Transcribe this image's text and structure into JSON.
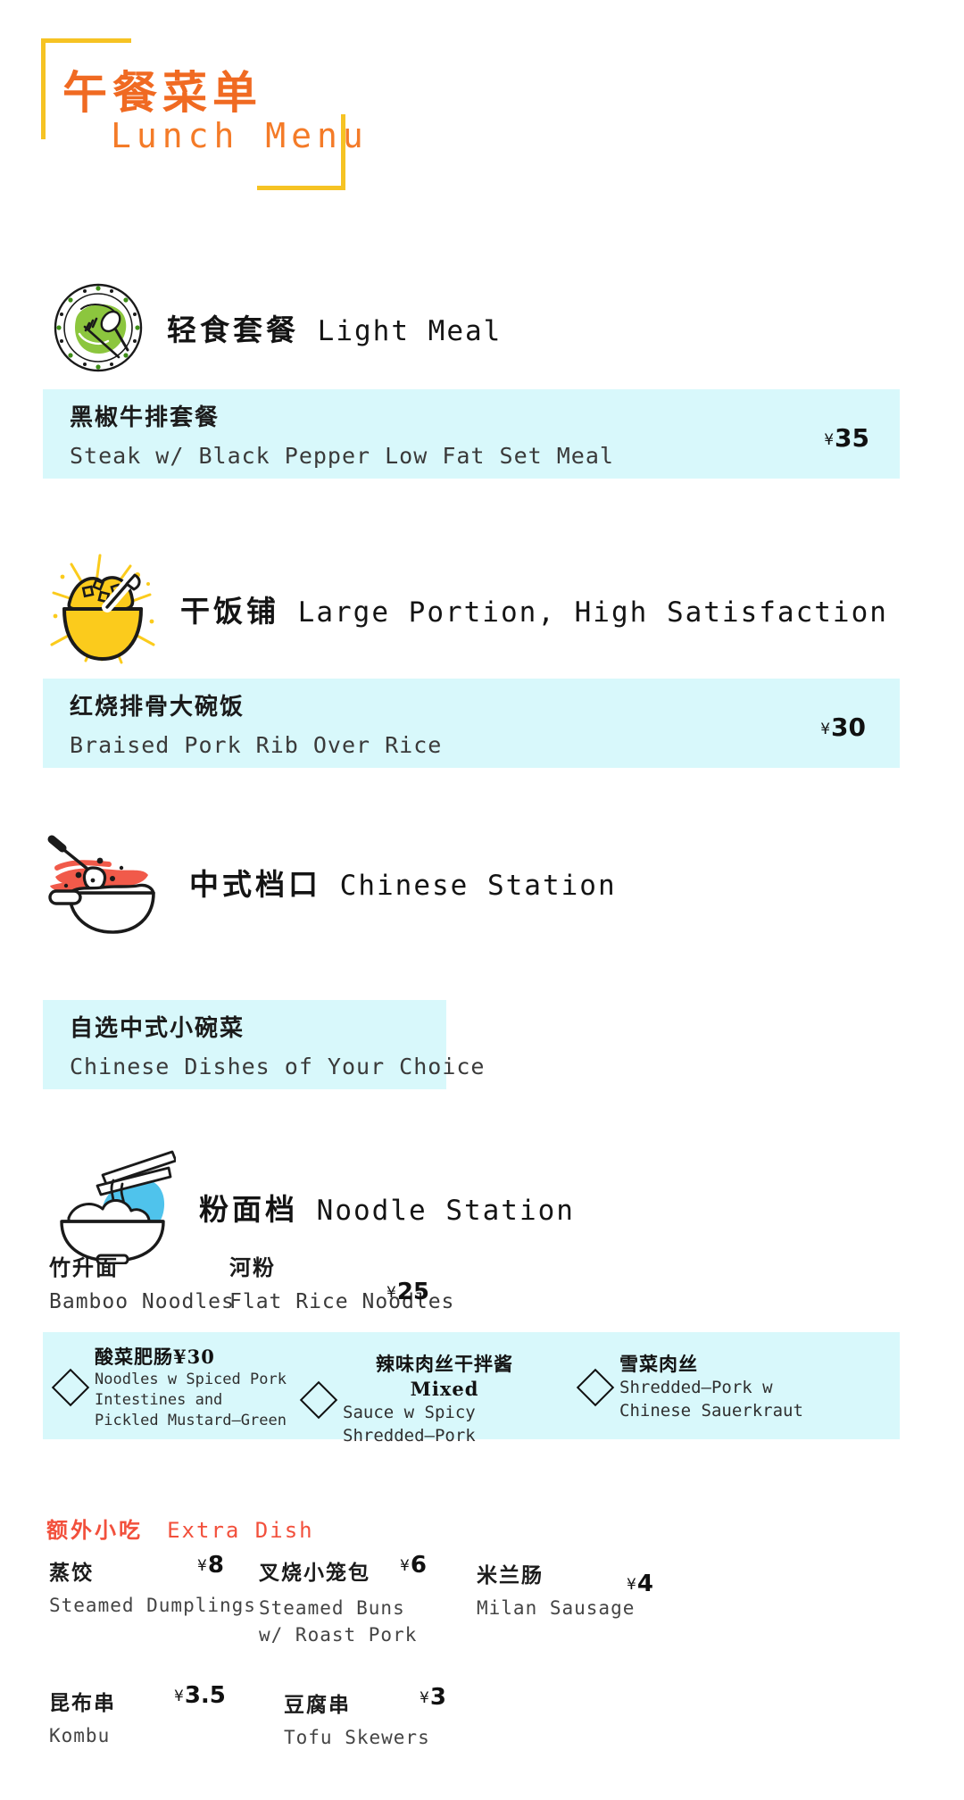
{
  "header": {
    "title_cn": "午餐菜单",
    "title_en": "Lunch  Menu",
    "accent_color": "#f6c323",
    "title_color": "#f06a22"
  },
  "theme": {
    "box_bg": "#d8f8fb",
    "extra_head_color": "#f2503c",
    "icon_green": "#8cc63e",
    "icon_yellow": "#fbcb1c",
    "icon_red": "#f15a4a",
    "icon_blue": "#4fc3ec"
  },
  "sections": [
    {
      "icon": "plate-fork-spoon-icon",
      "title_cn": "轻食套餐",
      "title_en": "Light Meal",
      "items": [
        {
          "name_cn": "黑椒牛排套餐",
          "name_en": "Steak w/ Black Pepper Low Fat Set Meal",
          "price": "35",
          "currency": "¥"
        }
      ]
    },
    {
      "icon": "rice-bowl-icon",
      "title_cn": "干饭铺",
      "title_en": "Large Portion, High Satisfaction",
      "items": [
        {
          "name_cn": "红烧排骨大碗饭",
          "name_en": "Braised Pork Rib Over Rice",
          "price": "30",
          "currency": "¥"
        }
      ]
    },
    {
      "icon": "ladle-bowl-icon",
      "title_cn": "中式档口",
      "title_en": "Chinese Station",
      "items": [
        {
          "name_cn": "自选中式小碗菜",
          "name_en": "Chinese Dishes of Your Choice",
          "price": "",
          "currency": ""
        }
      ]
    },
    {
      "icon": "noodle-bowl-chopsticks-icon",
      "title_cn": "粉面档",
      "title_en": "Noodle Station",
      "options": [
        {
          "name_cn": "竹升面",
          "name_en": "Bamboo Noodles"
        },
        {
          "name_cn": "河粉",
          "name_en": "Flat Rice Noodles"
        }
      ],
      "options_price": "25",
      "options_currency": "¥",
      "toppings": [
        {
          "name_cn": "酸菜肥肠¥30",
          "name_en": "Noodles w Spiced Pork Intestines and Pickled Mustard—Green"
        },
        {
          "name_cn": "辣味肉丝干拌酱Mixed",
          "name_en": "Sauce w Spicy Shredded—Pork"
        },
        {
          "name_cn": "雪菜肉丝",
          "name_en": "Shredded—Pork w Chinese Sauerkraut"
        }
      ]
    }
  ],
  "extra": {
    "title_cn": "额外小吃",
    "title_en": "Extra Dish",
    "items": [
      {
        "name_cn": "蒸饺",
        "name_en": "Steamed Dumplings",
        "price": "8",
        "currency": "¥"
      },
      {
        "name_cn": "叉烧小笼包",
        "name_en": "Steamed Buns w/ Roast Pork",
        "price": "6",
        "currency": "¥"
      },
      {
        "name_cn": "米兰肠",
        "name_en": "Milan Sausage",
        "price": "4",
        "currency": "¥"
      },
      {
        "name_cn": "昆布串",
        "name_en": "Kombu",
        "price": "3.5",
        "currency": "¥"
      },
      {
        "name_cn": "豆腐串",
        "name_en": "Tofu Skewers",
        "price": "3",
        "currency": "¥"
      }
    ]
  }
}
